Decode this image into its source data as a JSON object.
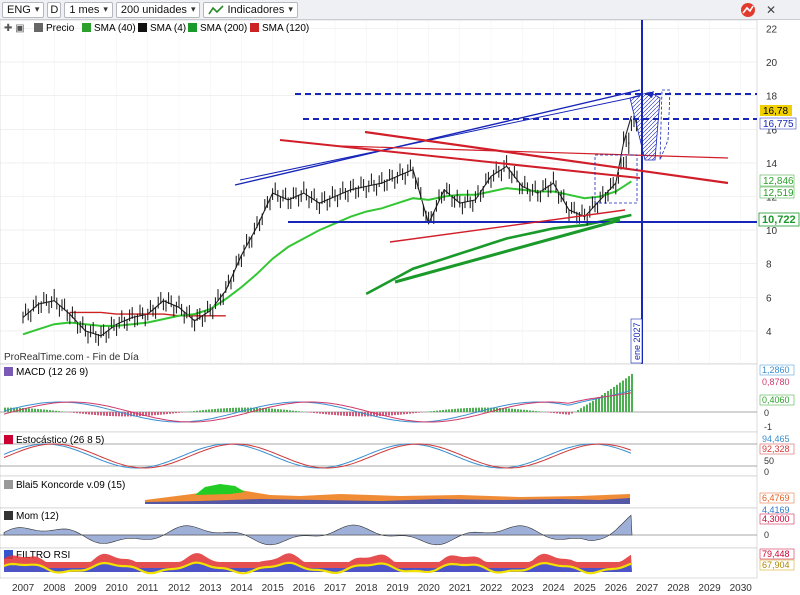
{
  "toolbar": {
    "symbol": "ENG",
    "d_button": "D",
    "timeframe": "1 mes",
    "units": "200 unidades",
    "indicators": "Indicadores"
  },
  "legend": {
    "price": "Precio",
    "sma40": "SMA (40)",
    "sma4": "SMA (4)",
    "sma200": "SMA (200)",
    "sma120": "SMA (120)"
  },
  "source_text": "ProRealTime.com - Fin de Día",
  "vertical_label": "ene 2027",
  "panels": {
    "macd": "MACD (12 26 9)",
    "stoch": "Estocástico (26 8 5)",
    "koncorde": "Blai5 Koncorde v.09 (15)",
    "mom": "Mom (12)",
    "rsi": "FILTRO RSI"
  },
  "price_axis": [
    "22",
    "20",
    "18",
    "16",
    "14",
    "12",
    "10",
    "8",
    "6",
    "4"
  ],
  "price_badges": {
    "last": "16,78",
    "line": "16,775",
    "sma_a": "12,846",
    "sma_b": "12,519",
    "support": "10,722"
  },
  "macd_axis": {
    "a": "1,2860",
    "b": "0,8780",
    "c": "0,4060",
    "zero": "0",
    "neg": "-1"
  },
  "stoch_axis": {
    "top": "94,465",
    "mid": "92,328",
    "v50": "50",
    "v0": "0"
  },
  "koncorde_axis": {
    "a": "6,4769",
    "b": "4,4169"
  },
  "mom_axis": {
    "a": "4,3000",
    "zero": "0"
  },
  "rsi_axis": {
    "a": "79,448",
    "b": "67,904"
  },
  "years": [
    "2007",
    "2008",
    "2009",
    "2010",
    "2011",
    "2012",
    "2013",
    "2014",
    "2015",
    "2016",
    "2017",
    "2018",
    "2019",
    "2020",
    "2021",
    "2022",
    "2023",
    "2024",
    "2025",
    "2026",
    "2027",
    "2028",
    "2029",
    "2030"
  ],
  "colors": {
    "sma40": "#2ca02c",
    "sma4": "#111111",
    "sma200": "#1a9a2a",
    "sma120": "#cc2222",
    "channel": "#1726b8",
    "red_lines": "#d11f2a"
  },
  "chart_data": {
    "type": "line",
    "title": "ENG",
    "xlabel": "",
    "ylabel": "",
    "x": [
      2007.0,
      2007.5,
      2008.0,
      2008.5,
      2009.0,
      2009.5,
      2010.0,
      2010.5,
      2011.0,
      2011.5,
      2012.0,
      2012.5,
      2013.0,
      2013.5,
      2014.0,
      2014.5,
      2015.0,
      2015.5,
      2016.0,
      2016.5,
      2017.0,
      2017.5,
      2018.0,
      2018.5,
      2019.0,
      2019.5,
      2020.0,
      2020.5,
      2021.0,
      2021.5,
      2022.0,
      2022.5,
      2023.0,
      2023.5,
      2024.0,
      2024.5,
      2025.0,
      2025.5,
      2026.0,
      2026.25,
      2026.5
    ],
    "ylim": [
      3,
      22.5
    ],
    "series": [
      {
        "name": "Precio",
        "values": [
          4.8,
          5.6,
          5.8,
          5.0,
          4.0,
          3.7,
          4.4,
          4.8,
          5.0,
          5.8,
          5.4,
          4.6,
          5.2,
          6.4,
          8.5,
          10.2,
          12.2,
          11.8,
          12.2,
          11.6,
          12.0,
          12.4,
          12.6,
          12.8,
          13.2,
          13.6,
          10.4,
          12.4,
          11.6,
          11.8,
          13.2,
          13.8,
          12.6,
          12.2,
          12.8,
          11.2,
          10.8,
          11.8,
          12.8,
          15.2,
          16.8
        ]
      },
      {
        "name": "SMA (200)",
        "values": [
          null,
          null,
          null,
          null,
          null,
          null,
          null,
          null,
          null,
          null,
          null,
          null,
          null,
          null,
          null,
          null,
          null,
          null,
          null,
          null,
          null,
          null,
          6.2,
          6.7,
          7.2,
          7.7,
          8.0,
          8.3,
          8.6,
          8.9,
          9.2,
          9.5,
          9.7,
          9.9,
          10.1,
          10.2,
          10.3,
          10.5,
          10.7,
          10.8,
          10.9
        ]
      },
      {
        "name": "SMA (120)",
        "values": [
          null,
          null,
          null,
          5.1,
          5.1,
          5.1,
          5.0,
          5.0,
          5.0,
          5.0,
          4.9,
          4.9,
          4.9,
          4.9,
          null,
          null,
          null,
          null,
          null,
          null,
          null,
          null,
          null,
          null,
          null,
          null,
          null,
          null,
          null,
          null,
          null,
          null,
          null,
          null,
          null,
          null,
          null,
          null,
          null,
          null,
          null
        ]
      },
      {
        "name": "SMA (40)",
        "values": [
          3.8,
          4.1,
          4.4,
          4.5,
          4.4,
          4.3,
          4.3,
          4.4,
          4.5,
          4.7,
          4.9,
          5.0,
          5.3,
          5.9,
          6.6,
          7.4,
          8.3,
          9.0,
          9.5,
          10.0,
          10.4,
          10.8,
          11.1,
          11.3,
          11.6,
          11.9,
          11.8,
          12.0,
          12.1,
          12.1,
          12.3,
          12.5,
          12.4,
          12.3,
          12.3,
          12.1,
          11.9,
          12.0,
          12.3,
          12.6,
          12.9
        ]
      }
    ]
  }
}
